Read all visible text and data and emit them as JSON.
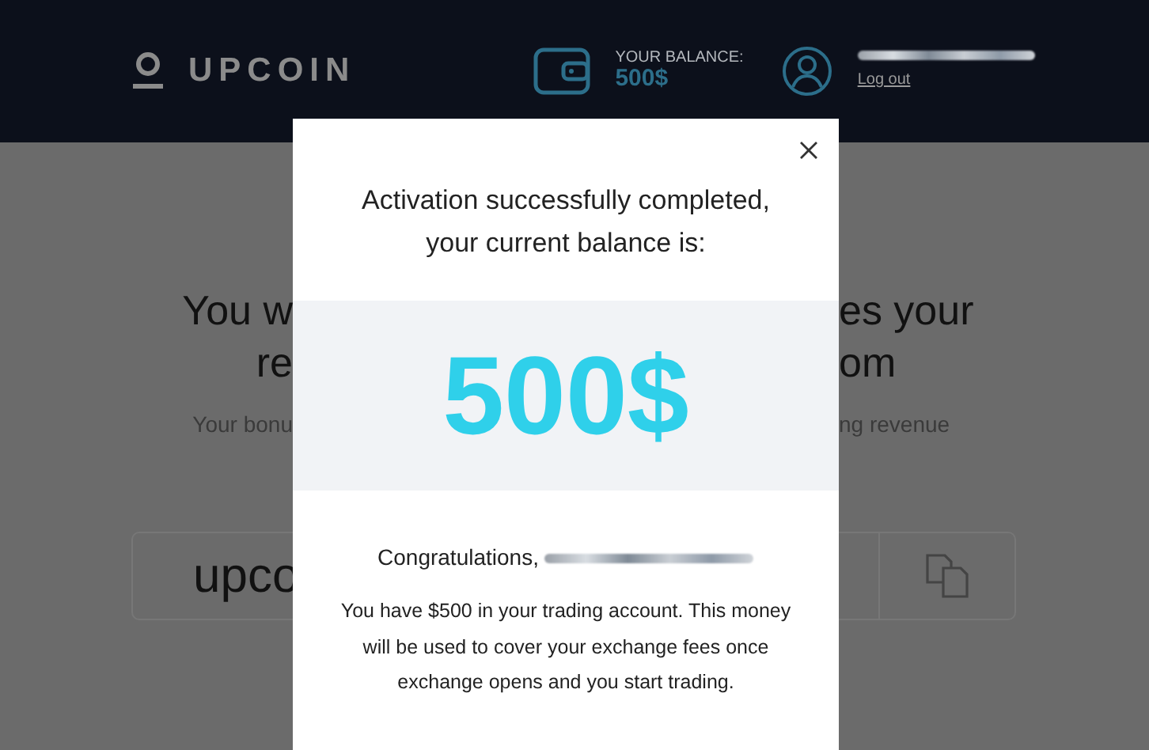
{
  "header": {
    "logo": "UPCOIN",
    "balance_label": "YOUR BALANCE:",
    "balance": "500$",
    "logout": "Log out"
  },
  "background": {
    "heading_lines": [
      {
        "left": "You w",
        "right": "es your"
      },
      {
        "left": "re",
        "right": "om"
      }
    ],
    "subtitle": {
      "left": "Your bonu",
      "right": "ng revenue"
    },
    "link_field": {
      "value": "upco"
    }
  },
  "modal": {
    "title": "Activation successfully completed, your current balance is:",
    "amount": "500$",
    "greeting": "Congratulations,",
    "message": "You have $500 in your trading account. This money will be used to cover your exchange fees once exchange opens and you start trading."
  }
}
